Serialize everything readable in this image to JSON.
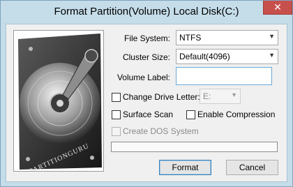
{
  "window": {
    "title": "Format Partition(Volume) Local Disk(C:)",
    "close_glyph": "✕"
  },
  "image_panel": {
    "icon": "hard-drive-illustration",
    "brand_text": "PARTITIONGURU"
  },
  "form": {
    "file_system": {
      "label": "File System:",
      "value": "NTFS"
    },
    "cluster_size": {
      "label": "Cluster Size:",
      "value": "Default(4096)"
    },
    "volume_label": {
      "label": "Volume Label:",
      "value": ""
    },
    "change_drive_letter": {
      "label": "Change Drive Letter:",
      "checked": false,
      "drive_value": "E:"
    },
    "surface_scan": {
      "label": "Surface Scan",
      "checked": false
    },
    "enable_compression": {
      "label": "Enable Compression",
      "checked": false
    },
    "create_dos_system": {
      "label": "Create DOS System",
      "checked": false,
      "disabled": true
    }
  },
  "progress": {
    "fraction": 0.0
  },
  "buttons": {
    "format": "Format",
    "cancel": "Cancel"
  },
  "colors": {
    "title_bar": "#c5dde9",
    "close_button": "#c7504d",
    "default_button_border": "#3c7fb1"
  }
}
